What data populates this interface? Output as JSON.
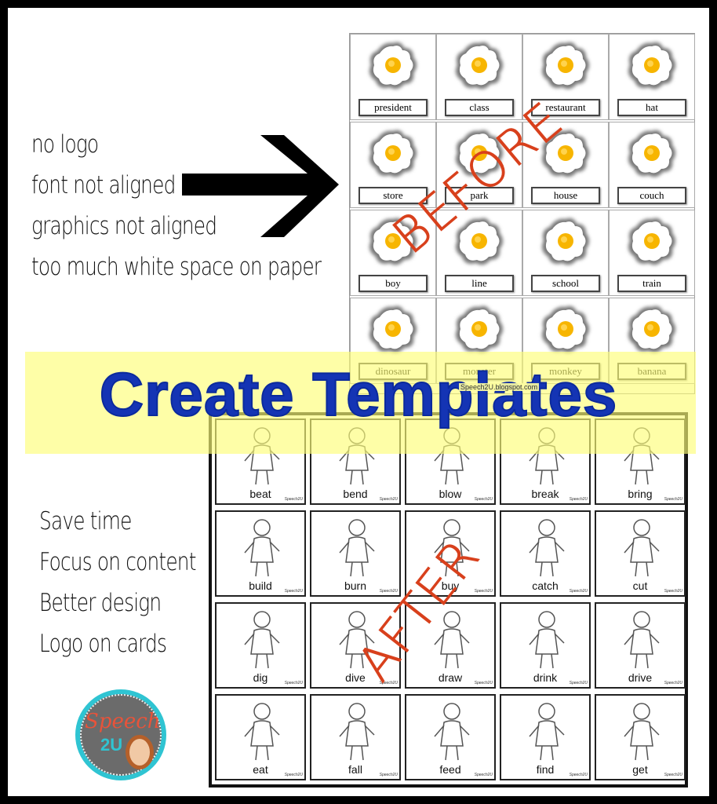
{
  "before_notes": [
    "no logo",
    "font not aligned",
    "graphics not aligned",
    "too much white space on paper"
  ],
  "after_notes": [
    "Save time",
    "Focus on content",
    "Better design",
    "Logo on cards"
  ],
  "before_label": "BEFORE",
  "after_label": "AFTER",
  "title": "Create Templates",
  "before_words": [
    "president",
    "class",
    "restaurant",
    "hat",
    "store",
    "park",
    "house",
    "couch",
    "boy",
    "line",
    "school",
    "train",
    "dinosaur",
    "monster",
    "monkey",
    "banana"
  ],
  "before_footer": "Speech2U.blogspot.com",
  "after_words": [
    "beat",
    "bend",
    "blow",
    "break",
    "bring",
    "build",
    "burn",
    "buy",
    "catch",
    "cut",
    "dig",
    "dive",
    "draw",
    "drink",
    "drive",
    "eat",
    "fall",
    "feed",
    "find",
    "get"
  ],
  "card_logo": "Speech2U",
  "logo": {
    "text": "Speech",
    "sub": "2U"
  },
  "colors": {
    "title": "#1434b4",
    "band": "#fdfd78",
    "stamp": "#d8401c",
    "logo_ring": "#2fc4d2"
  }
}
